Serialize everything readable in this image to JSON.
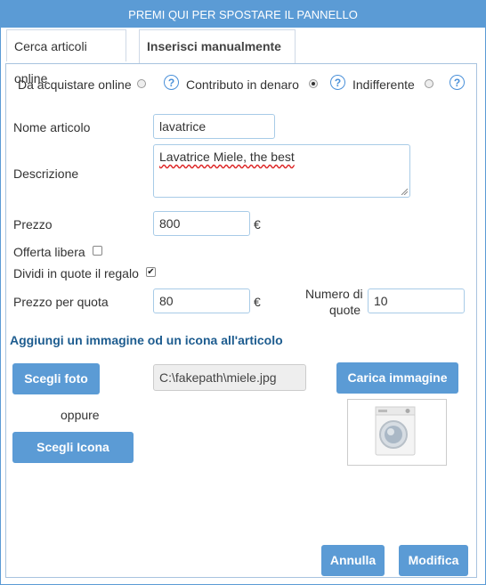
{
  "titlebar": {
    "text": "PREMI QUI PER SPOSTARE IL PANNELLO"
  },
  "tabs": [
    {
      "label": "Cerca articoli online"
    },
    {
      "label": "Inserisci manualmente"
    }
  ],
  "options": [
    {
      "label": "Da acquistare online",
      "selected": false
    },
    {
      "label": "Contributo in denaro",
      "selected": true
    },
    {
      "label": "Indifferente",
      "selected": false
    }
  ],
  "form": {
    "nome_label": "Nome articolo",
    "nome_value": "lavatrice",
    "descrizione_label": "Descrizione",
    "descrizione_value": "Lavatrice Miele, the best",
    "prezzo_label": "Prezzo",
    "prezzo_value": "800",
    "currency": "€",
    "offerta_label": "Offerta libera",
    "offerta_checked": false,
    "dividi_label": "Dividi in quote il regalo",
    "dividi_checked": true,
    "prezzo_quota_label": "Prezzo per quota",
    "prezzo_quota_value": "80",
    "numero_quote_label_1": "Numero di",
    "numero_quote_label_2": "quote",
    "numero_quote_value": "10"
  },
  "image_section": {
    "title": "Aggiungi un immagine od un icona all'articolo",
    "scegli_foto": "Scegli foto",
    "file_path": "C:\\fakepath\\miele.jpg",
    "carica_immagine": "Carica immagine",
    "oppure": "oppure",
    "scegli_icona": "Scegli Icona"
  },
  "footer": {
    "annulla": "Annulla",
    "modifica": "Modifica"
  },
  "colors": {
    "accent": "#5b9bd5",
    "section_title": "#1d5c8f"
  }
}
